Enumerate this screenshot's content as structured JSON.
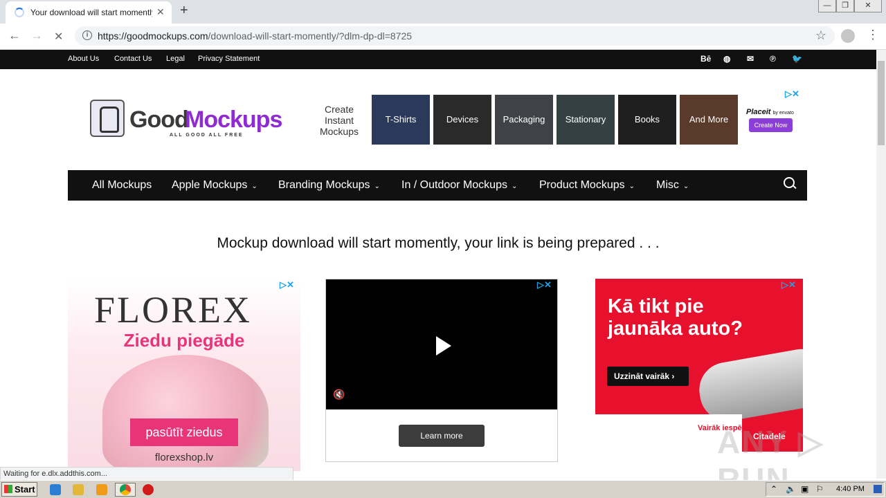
{
  "browser": {
    "tab_title": "Your download will start momently! -",
    "tab_close": "✕",
    "new_tab": "+",
    "url_host": "https://goodmockups.com",
    "url_path": "/download-will-start-momently/?dlm-dp-dl=8725",
    "back": "←",
    "forward": "→",
    "stop": "✕",
    "star": "☆",
    "menu": "⋮",
    "win_min": "—",
    "win_max": "❐",
    "win_close": "✕"
  },
  "topbar": {
    "links": [
      "About Us",
      "Contact Us",
      "Legal",
      "Privacy Statement"
    ],
    "social": [
      "Bē",
      "◍",
      "✉",
      "℗",
      "🐦"
    ]
  },
  "logo": {
    "good": "Good",
    "mockups": "Mockups",
    "tagline": "ALL GOOD ALL FREE"
  },
  "top_ad": {
    "text": "Create Instant Mockups",
    "tiles": [
      "T-Shirts",
      "Devices",
      "Packaging",
      "Stationary",
      "Books",
      "And More"
    ],
    "brand": "Placeit",
    "brand_small": "by envato",
    "cta": "Create Now"
  },
  "nav": {
    "items": [
      "All Mockups",
      "Apple Mockups",
      "Branding Mockups",
      "In / Outdoor Mockups",
      "Product Mockups",
      "Misc"
    ],
    "chevron": "⌄"
  },
  "message": "Mockup download will start momently, your link is being prepared . . .",
  "ad_florex": {
    "brand": "FLOREX",
    "subtitle": "Ziedu piegāde",
    "cta": "pasūtīt ziedus",
    "site": "florexshop.lv"
  },
  "ad_video": {
    "cta": "Learn more"
  },
  "ad_citadele": {
    "headline": "Kā tikt pie jaunāka auto?",
    "cta": "Uzzināt vairāk ›",
    "more": "Vairāk iespēju",
    "brand": "Citadele"
  },
  "adchoice": "▷✕",
  "status_text": "Waiting for e.dlx.addthis.com...",
  "watermark": "ANY ▷ RUN",
  "taskbar": {
    "start": "Start",
    "time": "4:40 PM",
    "icon_colors": [
      "#2a7fd4",
      "#e2b73a",
      "#f09a1a",
      "#4285f4",
      "#d11a1a"
    ]
  }
}
